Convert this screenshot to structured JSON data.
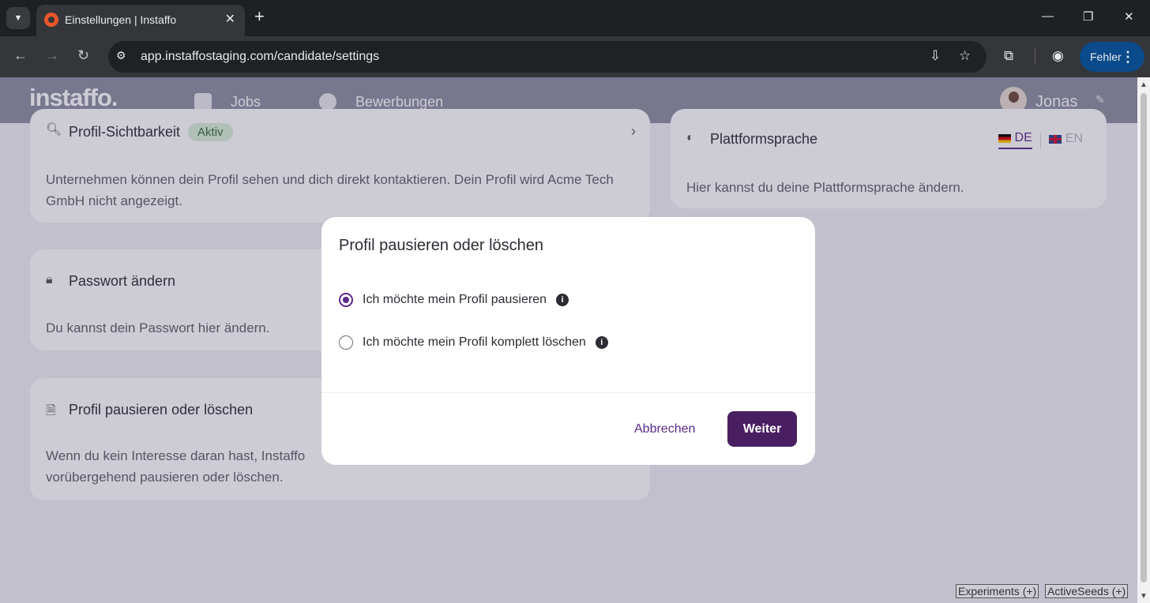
{
  "browser": {
    "tab_title": "Einstellungen | Instaffo",
    "url": "app.instaffostaging.com/candidate/settings",
    "profile_button_label": "Fehler"
  },
  "app": {
    "logo": "instaffo.",
    "nav": [
      {
        "label": "Jobs"
      },
      {
        "label": "Bewerbungen"
      }
    ],
    "user_name": "Jonas"
  },
  "cards": {
    "visibility": {
      "title": "Profil-Sichtbarkeit",
      "badge": "Aktiv",
      "text": "Unternehmen können dein Profil sehen und dich direkt kontaktieren. Dein Profil wird Acme Tech GmbH nicht angezeigt."
    },
    "password": {
      "title": "Passwort ändern",
      "text": "Du kannst dein Passwort hier ändern."
    },
    "pause": {
      "title": "Profil pausieren oder löschen",
      "text_line1": "Wenn du kein Interesse daran hast, Instaffo",
      "text_line2": "vorübergehend pausieren oder löschen."
    },
    "language": {
      "title": "Plattformsprache",
      "text": "Hier kannst du deine Plattformsprache ändern.",
      "options": [
        {
          "code": "DE",
          "active": true
        },
        {
          "code": "EN",
          "active": false
        }
      ]
    }
  },
  "modal": {
    "title": "Profil pausieren oder löschen",
    "options": [
      {
        "label": "Ich möchte mein Profil pausieren",
        "selected": true
      },
      {
        "label": "Ich möchte mein Profil komplett löschen",
        "selected": false
      }
    ],
    "cancel_label": "Abbrechen",
    "continue_label": "Weiter"
  },
  "devtools": {
    "experiments_label": "Experiments (+)",
    "seeds_label": "ActiveSeeds (+)"
  },
  "colors": {
    "brand_purple": "#4a1f62",
    "accent_purple": "#5b2a86",
    "badge_green": "#d8f1d9"
  }
}
